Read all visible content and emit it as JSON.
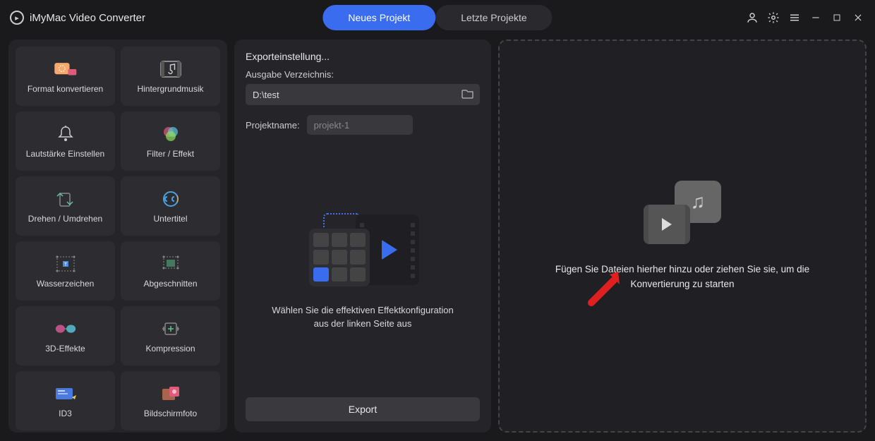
{
  "app": {
    "title": "iMyMac Video Converter"
  },
  "tabs": {
    "new": "Neues Projekt",
    "recent": "Letzte Projekte"
  },
  "tools": [
    {
      "id": "format-convert",
      "label": "Format konvertieren"
    },
    {
      "id": "bg-music",
      "label": "Hintergrundmusik"
    },
    {
      "id": "volume",
      "label": "Lautstärke Einstellen"
    },
    {
      "id": "filter-effect",
      "label": "Filter / Effekt"
    },
    {
      "id": "rotate-flip",
      "label": "Drehen / Umdrehen"
    },
    {
      "id": "subtitles",
      "label": "Untertitel"
    },
    {
      "id": "watermark",
      "label": "Wasserzeichen"
    },
    {
      "id": "crop",
      "label": "Abgeschnitten"
    },
    {
      "id": "3d-effects",
      "label": "3D-Effekte"
    },
    {
      "id": "compression",
      "label": "Kompression"
    },
    {
      "id": "id3",
      "label": "ID3"
    },
    {
      "id": "screenshot",
      "label": "Bildschirmfoto"
    }
  ],
  "export": {
    "title": "Exporteinstellung...",
    "outDirLabel": "Ausgabe Verzeichnis:",
    "outDirValue": "D:\\test",
    "projectNameLabel": "Projektname:",
    "projectNamePlaceholder": "projekt-1",
    "effectHint": "Wählen Sie die effektiven Effektkonfiguration aus der linken Seite aus",
    "exportButton": "Export"
  },
  "dropzone": {
    "text": "Fügen Sie Dateien hierher hinzu oder ziehen Sie sie, um die Konvertierung zu starten"
  }
}
